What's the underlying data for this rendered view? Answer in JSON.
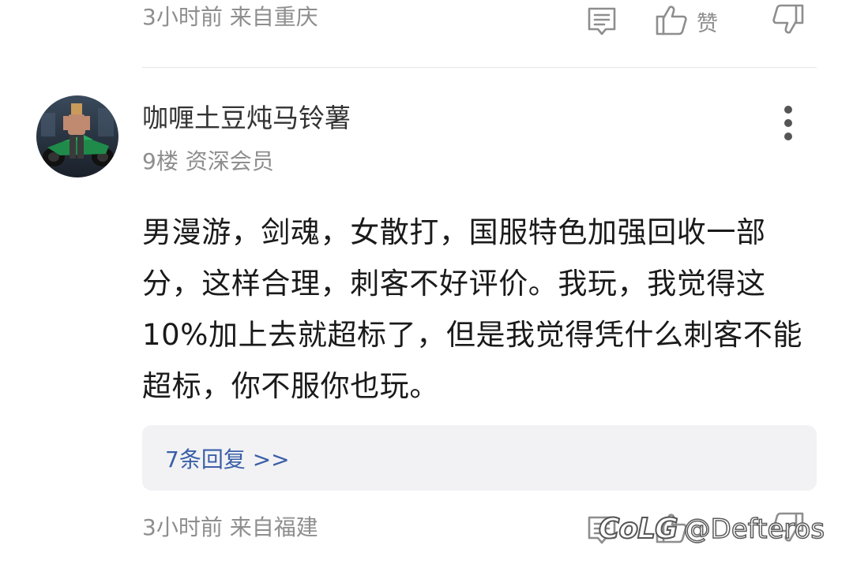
{
  "previous_comment": {
    "time_location": "3小时前 来自重庆",
    "like_label": "赞"
  },
  "comment": {
    "username": "咖喱土豆炖马铃薯",
    "floor_member": "9楼 资深会员",
    "text": "男漫游，剑魂，女散打，国服特色加强回收一部分，这样合理，刺客不好评价。我玩，我觉得这10%加上去就超标了，但是我觉得凭什么刺客不能超标，你不服你也玩。",
    "replies_link": "7条回复 >>",
    "time_location": "3小时前 来自福建"
  },
  "watermark": {
    "logo": "CoLG",
    "handle": "@Defteros"
  },
  "icons": {
    "reply": "comment-icon",
    "like": "thumbs-up-icon",
    "dislike": "thumbs-down-icon",
    "more": "more-vertical-icon",
    "avatar": "avatar"
  },
  "colors": {
    "link": "#3b5fa8",
    "meta": "#8e8e8e",
    "reply_box_bg": "#f2f2f4"
  }
}
